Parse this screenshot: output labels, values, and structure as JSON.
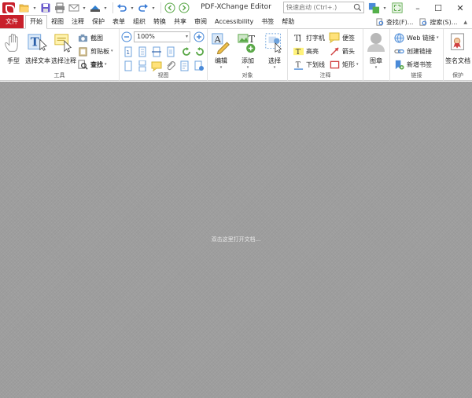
{
  "window": {
    "title": "PDF-XChange Editor",
    "search_placeholder": "快速启动 (Ctrl+.)"
  },
  "menu": {
    "tabs": [
      "文件",
      "开始",
      "视图",
      "注释",
      "保护",
      "表单",
      "组织",
      "转换",
      "共享",
      "审阅",
      "Accessibility",
      "书签",
      "帮助"
    ],
    "active_index": 1,
    "find_label": "查找(F)...",
    "search_label": "搜索(S)..."
  },
  "ribbon": {
    "tools": {
      "label": "工具",
      "hand": "手型",
      "select_text": "选择文本",
      "select_annot": "选择注释",
      "snapshot": "截图",
      "clipboard": "剪贴板",
      "find": "查找"
    },
    "view": {
      "label": "视图",
      "zoom": "100%"
    },
    "objects": {
      "label": "对象",
      "edit": "编辑",
      "add": "添加",
      "select": "选择"
    },
    "annotate": {
      "label": "注释",
      "typewriter": "打字机",
      "note": "便签",
      "highlight": "高亮",
      "arrow": "箭头",
      "underline": "下划线",
      "rectangle": "矩形"
    },
    "stamp": {
      "label": "图章"
    },
    "links": {
      "label": "链接",
      "web_links": "Web 链接",
      "create_link": "创建链接",
      "new_bookmark": "新增书签"
    },
    "protect": {
      "label": "保护",
      "sign": "签名文档"
    }
  },
  "main": {
    "hint": "双击这里打开文档..."
  },
  "colors": {
    "brand": "#c8202b",
    "workspace": "#9e9e9e"
  }
}
